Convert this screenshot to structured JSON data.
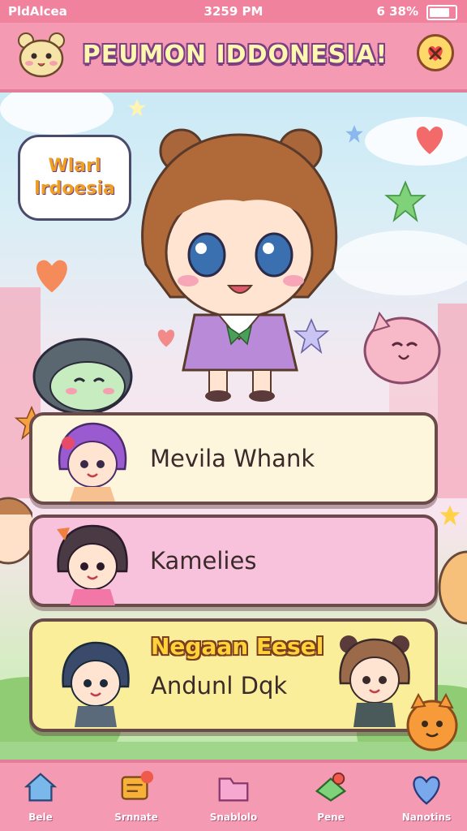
{
  "status_bar": {
    "carrier": "PldAlcea",
    "time": "3259 PM",
    "battery": "6 38%"
  },
  "header": {
    "title": "PEUMON IDDONESIA!",
    "mascot_icon": "bear-mascot-icon",
    "button_icon": "close-heart-icon"
  },
  "speech_bubble": {
    "line1": "Wlarl",
    "line2": "lrdoesia"
  },
  "menu": {
    "items": [
      {
        "label": "Mevila Whank",
        "avatar": "purple-hair-girl"
      },
      {
        "label": "Kamelies",
        "avatar": "dark-hair-girl"
      },
      {
        "title": "Negaan Eesel",
        "label": "Andunl Dqk",
        "avatars": [
          "blue-hair-boy",
          "brown-bear-girl"
        ]
      }
    ]
  },
  "bottom_nav": {
    "items": [
      {
        "label": "Bele",
        "icon": "home-icon"
      },
      {
        "label": "Srnnate",
        "icon": "message-icon"
      },
      {
        "label": "Snablolo",
        "icon": "folder-icon"
      },
      {
        "label": "Pene",
        "icon": "map-icon"
      },
      {
        "label": "Nanotins",
        "icon": "heart-icon"
      }
    ]
  },
  "colors": {
    "header_pink": "#f49ab3",
    "title_yellow": "#fff7b0",
    "title_outline": "#7c3f86",
    "card_cream": "#fdf6dc",
    "card_pink": "#f9c2dc",
    "card_yellow": "#fbee9a"
  }
}
